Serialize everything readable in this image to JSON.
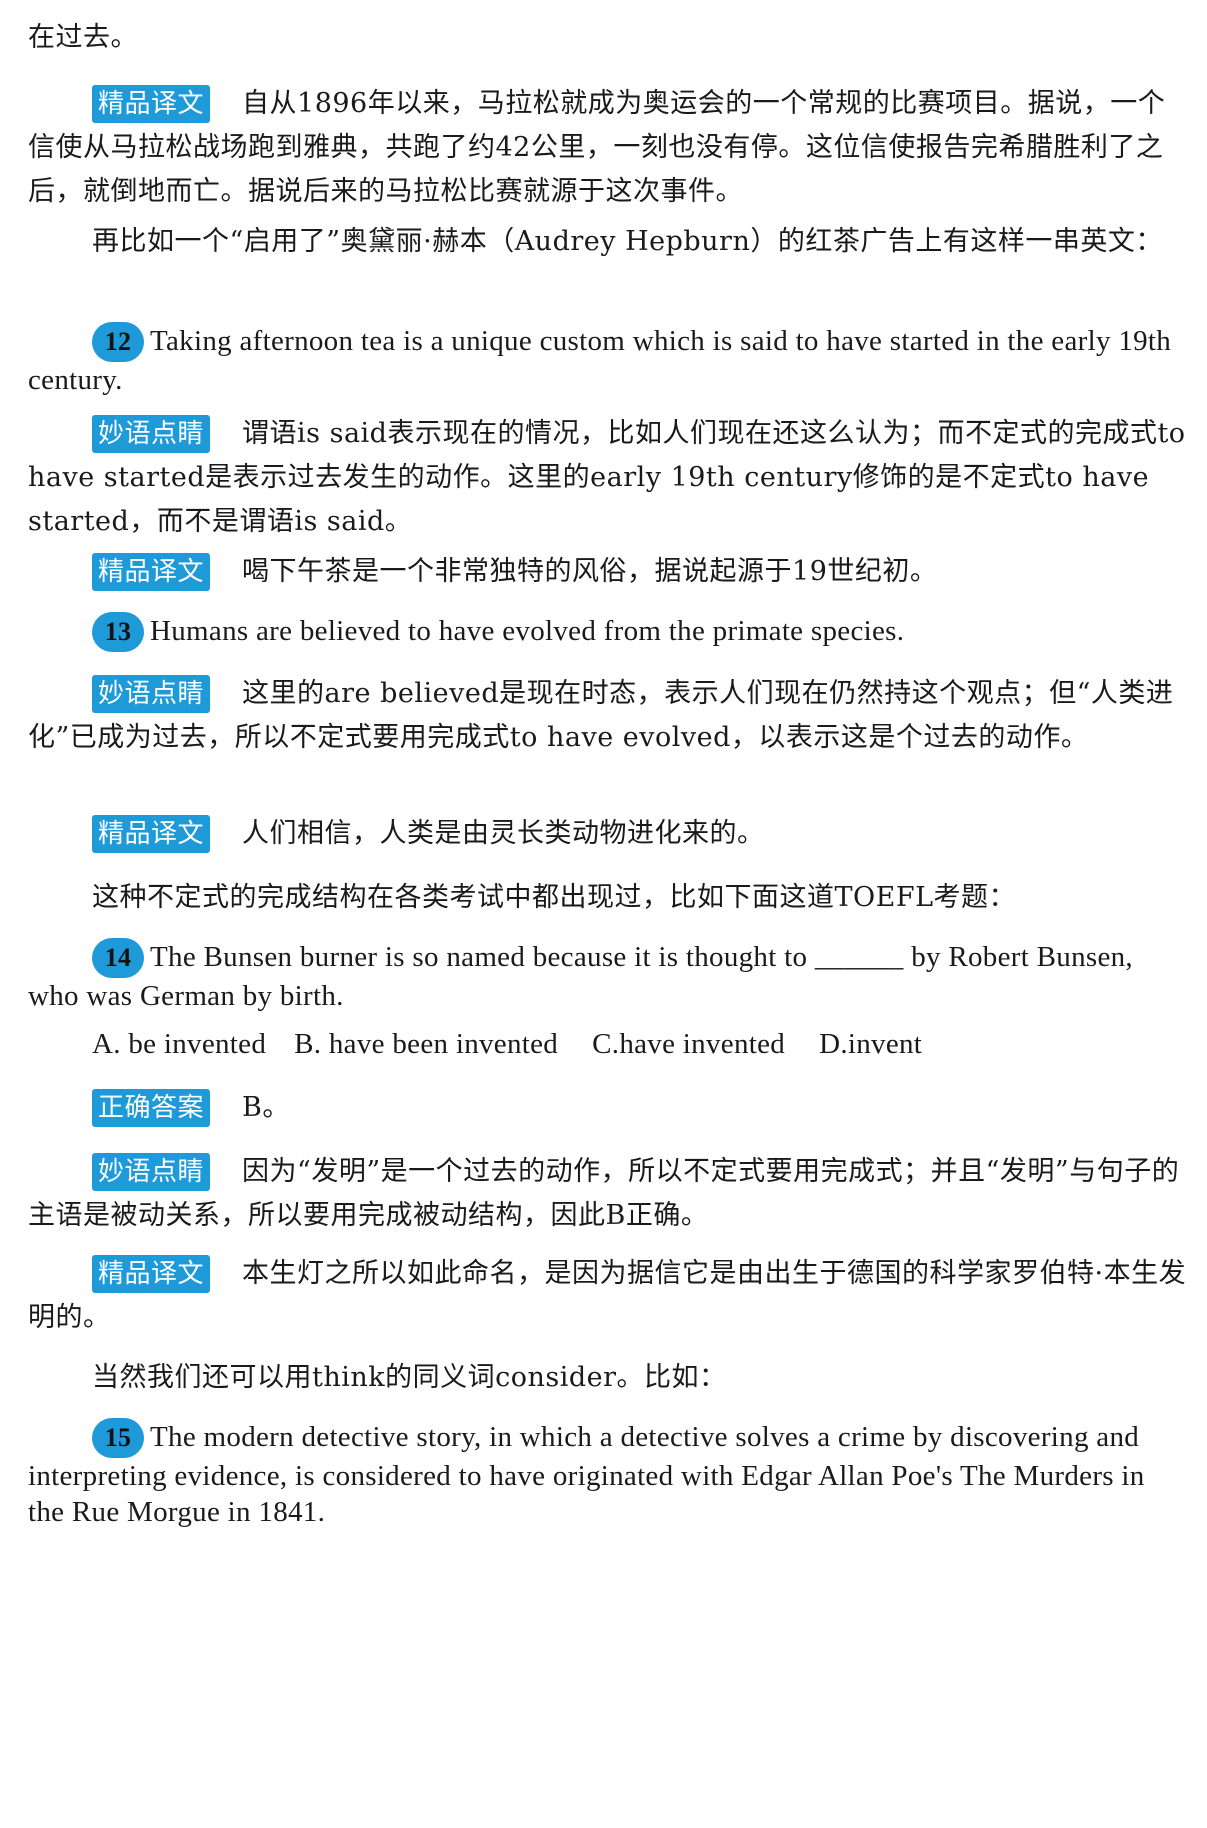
{
  "tags": {
    "translation": "精品译文",
    "analysis": "妙语点睛",
    "answer": "正确答案"
  },
  "blocks": {
    "b0": "在过去。",
    "b1": "自从1896年以来，马拉松就成为奥运会的一个常规的比赛项目。据说，一个信使从马拉松战场跑到雅典，共跑了约42公里，一刻也没有停。这位信使报告完希腊胜利了之后，就倒地而亡。据说后来的马拉松比赛就源于这次事件。",
    "b2": "再比如一个“启用了”奥黛丽·赫本（Audrey Hepburn）的红茶广告上有这样一串英文：",
    "ex12_num": "12",
    "ex12": "Taking afternoon tea is a unique custom which is said to have started in the early 19th century.",
    "b3": "谓语is said表示现在的情况，比如人们现在还这么认为；而不定式的完成式to have started是表示过去发生的动作。这里的early 19th century修饰的是不定式to have started，而不是谓语is said。",
    "b4": "喝下午茶是一个非常独特的风俗，据说起源于19世纪初。",
    "ex13_num": "13",
    "ex13": "Humans are believed to have evolved from the primate species.",
    "b5": "这里的are believed是现在时态，表示人们现在仍然持这个观点；但“人类进化”已成为过去，所以不定式要用完成式to have evolved，以表示这是个过去的动作。",
    "b6": "人们相信，人类是由灵长类动物进化来的。",
    "b7": "这种不定式的完成结构在各类考试中都出现过，比如下面这道TOEFL考题：",
    "ex14_num": "14",
    "ex14": "The Bunsen burner is so named because it is thought to ______ by Robert Bunsen, who was German by birth.",
    "options": [
      "A. be invented",
      "B. have been invented",
      "C.have invented",
      "D.invent"
    ],
    "b8": "B。",
    "b9": "因为“发明”是一个过去的动作，所以不定式要用完成式；并且“发明”与句子的主语是被动关系，所以要用完成被动结构，因此B正确。",
    "b10": "本生灯之所以如此命名，是因为据信它是由出生于德国的科学家罗伯特·本生发明的。",
    "b11": "当然我们还可以用think的同义词consider。比如：",
    "ex15_num": "15",
    "ex15": "The modern detective story, in which a detective solves a crime by discovering and interpreting evidence, is considered to have originated with Edgar Allan Poe's The Murders in the Rue Morgue in 1841."
  },
  "colors": {
    "accent": "#1e9ad9",
    "text": "#1a1a1a"
  }
}
